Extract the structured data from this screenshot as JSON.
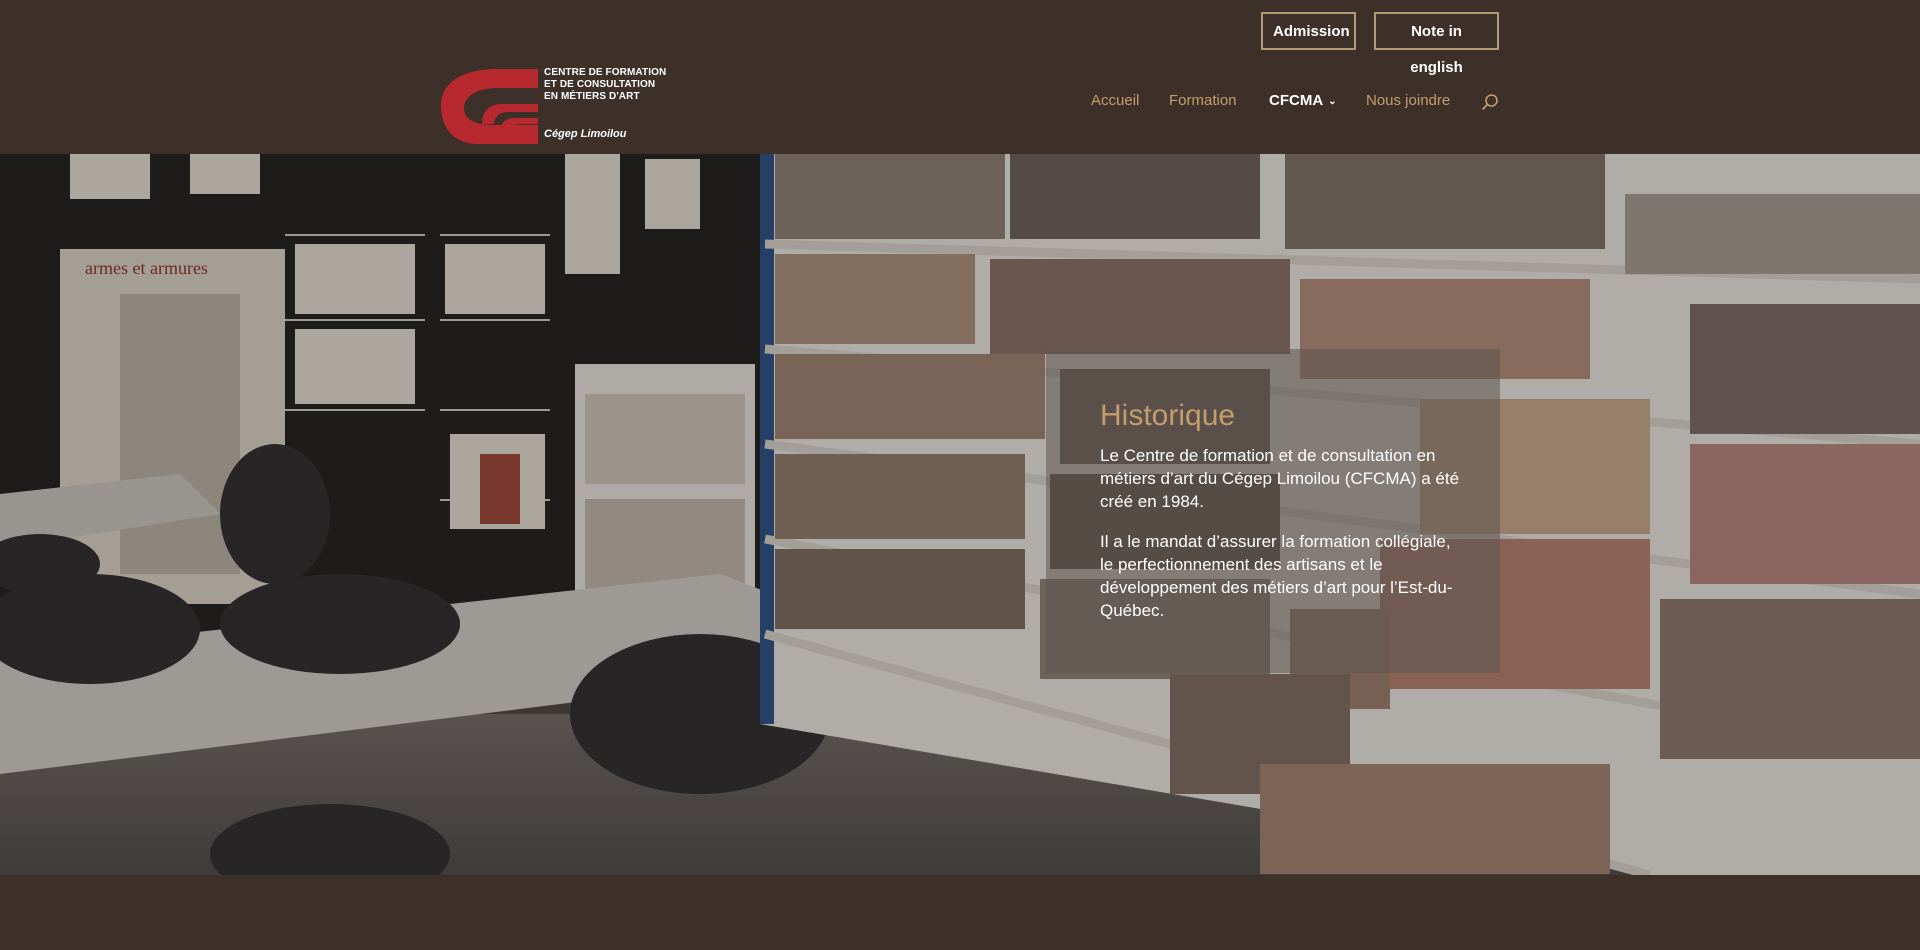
{
  "header": {
    "top_buttons": [
      {
        "label": "Admission"
      },
      {
        "label": "Note in english"
      }
    ],
    "logo": {
      "lines": [
        "CENTRE DE FORMATION",
        "ET DE CONSULTATION",
        "EN MÉTIERS D'ART"
      ],
      "subline": "Cégep Limoilou",
      "mark_color": "#b7292f"
    },
    "nav": [
      {
        "label": "Accueil"
      },
      {
        "label": "Formation"
      },
      {
        "label": "CFCMA",
        "active": true,
        "has_dropdown": true
      },
      {
        "label": "Nous joindre"
      }
    ],
    "search_icon": "search-icon"
  },
  "hero": {
    "title": "Historique",
    "paragraphs": [
      "Le Centre de formation et de consultation en métiers d’art du Cégep Limoilou (CFCMA) a été créé en 1984.",
      "Il a le mandat d’assurer la formation collégiale, le perfectionnement des artisans et le développement des métiers d’art pour l’Est-du-Québec."
    ]
  },
  "colors": {
    "background": "#3d3028",
    "accent": "#c49d6c",
    "button_border": "#b59a75",
    "text": "#ffffff"
  }
}
